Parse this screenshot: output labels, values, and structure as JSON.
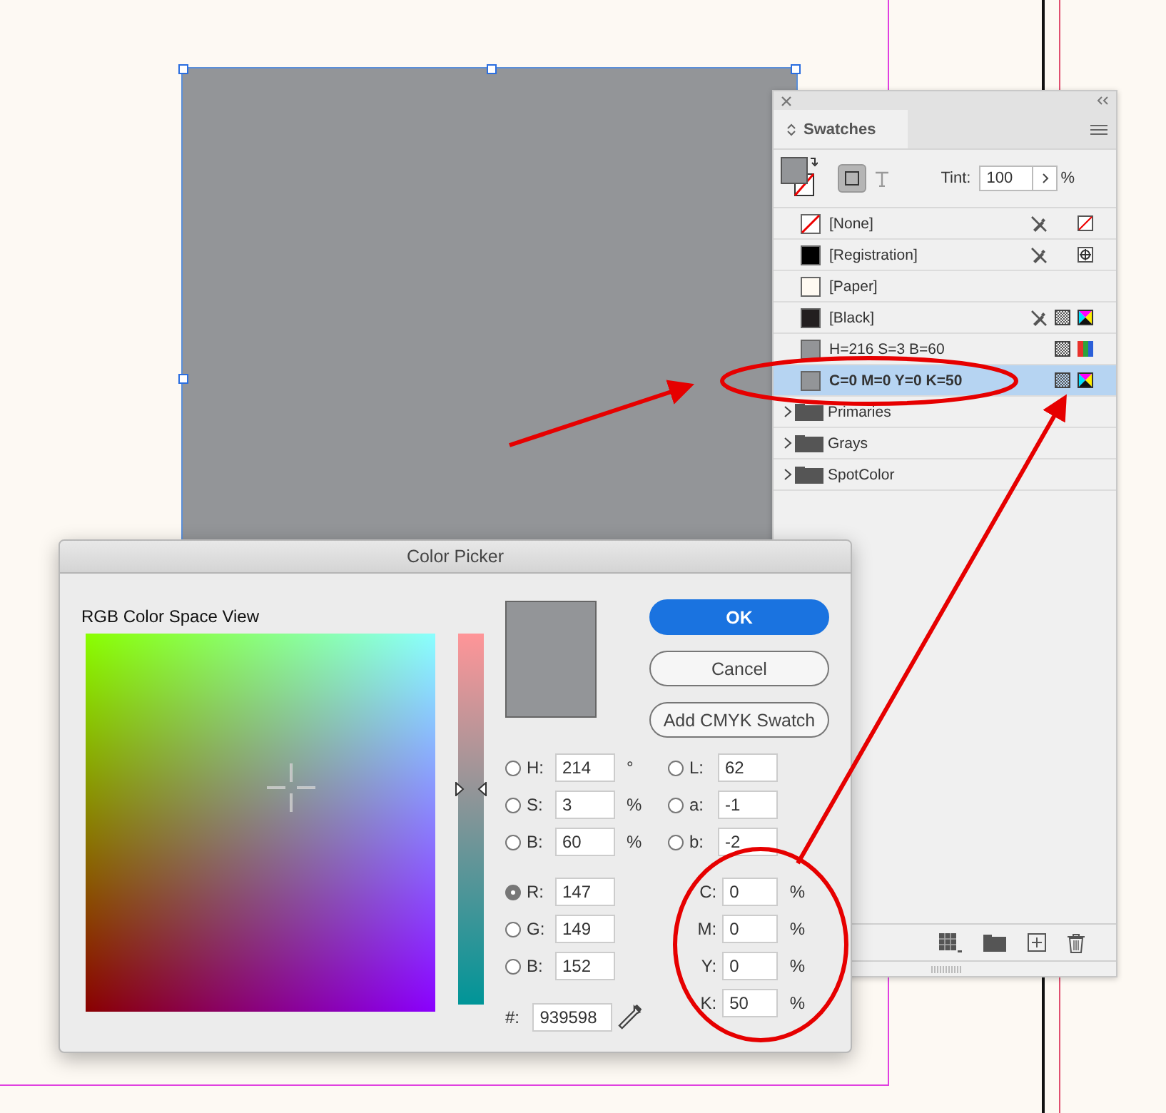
{
  "swatches_panel": {
    "title": "Swatches",
    "tint": {
      "label": "Tint:",
      "value": "100",
      "unit": "%"
    },
    "swatches": [
      {
        "name": "[None]",
        "kind": "none",
        "selected": false,
        "locked": true,
        "process": false
      },
      {
        "name": "[Registration]",
        "kind": "registration",
        "color": "#000000",
        "selected": false,
        "locked": true,
        "process": false
      },
      {
        "name": "[Paper]",
        "kind": "paper",
        "color": "#fffaf2",
        "selected": false,
        "locked": false,
        "process": false
      },
      {
        "name": "[Black]",
        "kind": "cmyk",
        "color": "#231f20",
        "selected": false,
        "locked": true,
        "process": true
      },
      {
        "name": "H=216 S=3 B=60",
        "kind": "rgb",
        "color": "#939598",
        "selected": false,
        "locked": false,
        "process": true
      },
      {
        "name": "C=0 M=0 Y=0 K=50",
        "kind": "cmyk",
        "color": "#939598",
        "selected": true,
        "locked": false,
        "process": true
      }
    ],
    "groups": [
      {
        "name": "Primaries",
        "expanded": false
      },
      {
        "name": "Grays",
        "expanded": false
      },
      {
        "name": "SpotColor",
        "expanded": false
      }
    ]
  },
  "color_picker": {
    "title": "Color Picker",
    "view_label": "RGB Color Space View",
    "slider": {
      "level": 0.58
    },
    "buttons": [
      {
        "label": "OK",
        "kind": "primary"
      },
      {
        "label": "Cancel",
        "kind": "secondary"
      },
      {
        "label": "Add CMYK Swatch",
        "kind": "secondary"
      }
    ],
    "hsb": [
      {
        "label": "H:",
        "value": "214",
        "unit": "°",
        "selected": false
      },
      {
        "label": "S:",
        "value": "3",
        "unit": "%",
        "selected": false
      },
      {
        "label": "B:",
        "value": "60",
        "unit": "%",
        "selected": false
      }
    ],
    "rgb": [
      {
        "label": "R:",
        "value": "147",
        "selected": true
      },
      {
        "label": "G:",
        "value": "149",
        "selected": false
      },
      {
        "label": "B:",
        "value": "152",
        "selected": false
      }
    ],
    "hex": {
      "label": "#:",
      "value": "939598"
    },
    "lab": [
      {
        "label": "L:",
        "value": "62",
        "selected": false
      },
      {
        "label": "a:",
        "value": "-1",
        "selected": false
      },
      {
        "label": "b:",
        "value": "-2",
        "selected": false
      }
    ],
    "cmyk": [
      {
        "label": "C:",
        "value": "0",
        "unit": "%"
      },
      {
        "label": "M:",
        "value": "0",
        "unit": "%"
      },
      {
        "label": "Y:",
        "value": "0",
        "unit": "%"
      },
      {
        "label": "K:",
        "value": "50",
        "unit": "%"
      }
    ]
  }
}
